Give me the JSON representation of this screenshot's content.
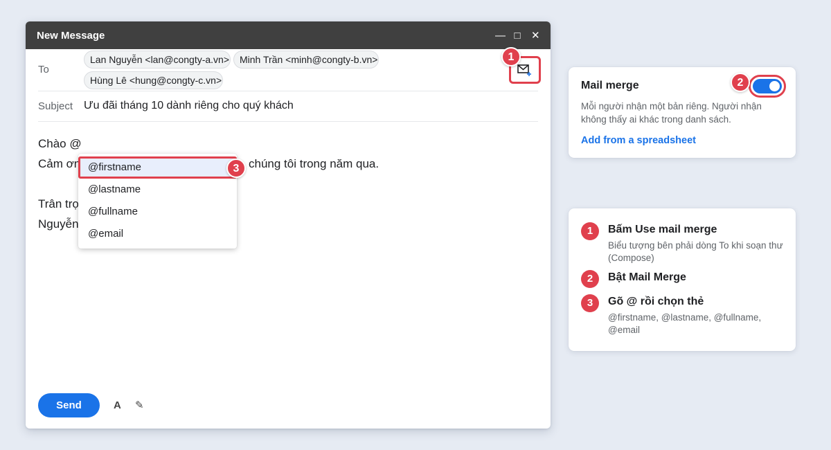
{
  "compose": {
    "title": "New Message",
    "controls": {
      "minimize": "—",
      "maximize": "□",
      "close": "✕"
    },
    "to_label": "To",
    "recipients": [
      "Lan Nguyễn <lan@congty-a.vn>",
      "Minh Trần <minh@congty-b.vn>",
      "Hùng Lê <hung@congty-c.vn>"
    ],
    "subject_label": "Subject",
    "subject": "Ưu đãi tháng 10 dành riêng cho quý khách",
    "body": {
      "line1": "Chào @",
      "line2_start": "Cảm ơn",
      "line2_end": "chúng tôi trong năm qua.",
      "line3": "Trân trọng,",
      "line4": "Nguyễn"
    },
    "suggestions": [
      "@firstname",
      "@lastname",
      "@fullname",
      "@email"
    ],
    "send_label": "Send",
    "format_icon": "A",
    "pen_icon": "✎"
  },
  "badges": {
    "b1": "1",
    "b2": "2",
    "b3": "3"
  },
  "mail_merge": {
    "title": "Mail merge",
    "description": "Mỗi người nhận một bản riêng. Người nhận không thấy ai khác trong danh sách.",
    "link": "Add from a spreadsheet",
    "enabled": true
  },
  "steps": [
    {
      "num": "1",
      "title": "Bấm Use mail merge",
      "desc": "Biểu tượng bên phải dòng To khi soạn thư (Compose)"
    },
    {
      "num": "2",
      "title": "Bật Mail Merge",
      "desc": ""
    },
    {
      "num": "3",
      "title": "Gõ @ rồi chọn thẻ",
      "desc": "@firstname, @lastname, @fullname, @email"
    }
  ],
  "colors": {
    "accent": "#1a73e8",
    "highlight": "#e0404d",
    "titlebar": "#404040"
  }
}
